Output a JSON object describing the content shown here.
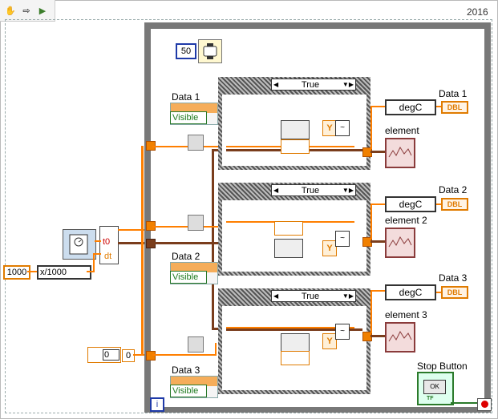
{
  "version_label": "2016",
  "toolbar": {
    "items": [
      {
        "name": "hand-tool",
        "glyph": "✋"
      },
      {
        "name": "arrow-forward",
        "glyph": "⇨"
      },
      {
        "name": "run",
        "glyph": "▶"
      }
    ]
  },
  "wait_ms": "50",
  "timing": {
    "t0": "t0",
    "dt": "dt",
    "const_1000": "1000",
    "expr": "x/1000"
  },
  "init": {
    "zero": "0",
    "zero_small": "0"
  },
  "cases": [
    {
      "selector": "True"
    },
    {
      "selector": "True"
    },
    {
      "selector": "True"
    }
  ],
  "data_controls": [
    {
      "label": "Data 1",
      "value": "Visible"
    },
    {
      "label": "Data 2",
      "value": "Visible"
    },
    {
      "label": "Data 3",
      "value": "Visible"
    }
  ],
  "outputs": [
    {
      "unit": "degC",
      "type": "DBL",
      "label": "Data 1",
      "graph_label": "element"
    },
    {
      "unit": "degC",
      "type": "DBL",
      "label": "Data 2",
      "graph_label": "element 2"
    },
    {
      "unit": "degC",
      "type": "DBL",
      "label": "Data 3",
      "graph_label": "element 3"
    }
  ],
  "stop": {
    "label": "Stop Button",
    "button_text": "OK",
    "tf": "TF"
  },
  "iteration": "i",
  "colors": {
    "orange_wire": "#ff7f00",
    "brown_wire": "#7a3d1c",
    "loop_gray": "#787878"
  }
}
